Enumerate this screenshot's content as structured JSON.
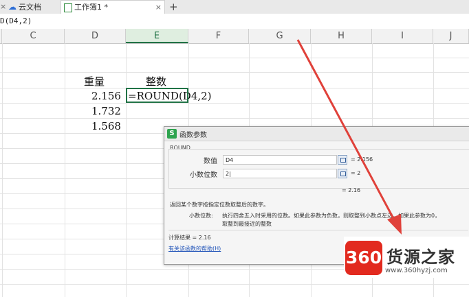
{
  "tabs": {
    "close_glyph": "×",
    "cloud_label": "云文档",
    "workbook_label": "工作簿1 *",
    "new_tab": "+"
  },
  "formula_bar": {
    "text": "D(D4,2)"
  },
  "columns": [
    "C",
    "D",
    "E",
    "F",
    "G",
    "H",
    "I",
    "J"
  ],
  "selected_column": "E",
  "cells": {
    "D3": "重量",
    "E3": "整数",
    "D4": "2.156",
    "E4": "=ROUND(D4,2)",
    "D5": "1.732",
    "D6": "1.568"
  },
  "dialog": {
    "title": "函数参数",
    "function_name": "ROUND",
    "args": [
      {
        "label": "数值",
        "input": "D4",
        "result": "= 2.156"
      },
      {
        "label": "小数位数",
        "input": "2|",
        "result": "= 2"
      }
    ],
    "overall_result": "= 2.16",
    "description": "返回某个数字按指定位数取整后的数字。",
    "param_name": "小数位数:",
    "param_desc_line1": "执行四舍五入时采用的位数。如果此参数为负数，则取整到小数点左边，如果此参数为0，",
    "param_desc_line2": "取整到最接近的整数",
    "calc_label": "计算结果 = 2.16",
    "help_link": "有关该函数的帮助(H)"
  },
  "watermark": {
    "badge": "360",
    "name": "货源之家",
    "url": "www.360hyzj.com"
  },
  "colors": {
    "accent": "#217346",
    "arrow": "#e0413a",
    "badge": "#e22a1f"
  }
}
